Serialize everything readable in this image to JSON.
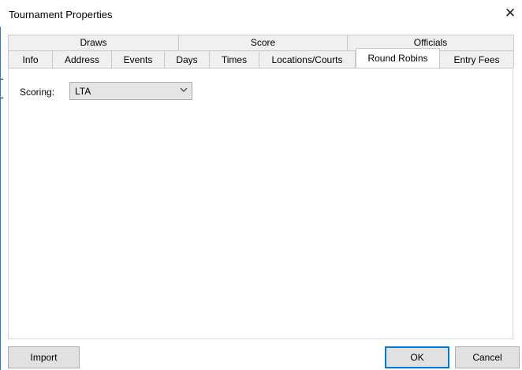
{
  "window": {
    "title": "Tournament Properties",
    "close_glyph": "✕"
  },
  "tabs": {
    "row_back": [
      {
        "label": "Draws"
      },
      {
        "label": "Score"
      },
      {
        "label": "Officials"
      }
    ],
    "row_front": [
      {
        "label": "Info"
      },
      {
        "label": "Address"
      },
      {
        "label": "Events"
      },
      {
        "label": "Days"
      },
      {
        "label": "Times"
      },
      {
        "label": "Locations/Courts"
      },
      {
        "label": "Round Robins",
        "active": true
      },
      {
        "label": "Entry Fees"
      }
    ]
  },
  "panel": {
    "scoring_label": "Scoring:",
    "scoring_value": "LTA",
    "dropdown_icon": "chevron-down-icon"
  },
  "buttons": {
    "import": "Import",
    "ok": "OK",
    "cancel": "Cancel"
  },
  "colors": {
    "ok_border": "#0078d7",
    "window_edge": "#2b79d0"
  }
}
